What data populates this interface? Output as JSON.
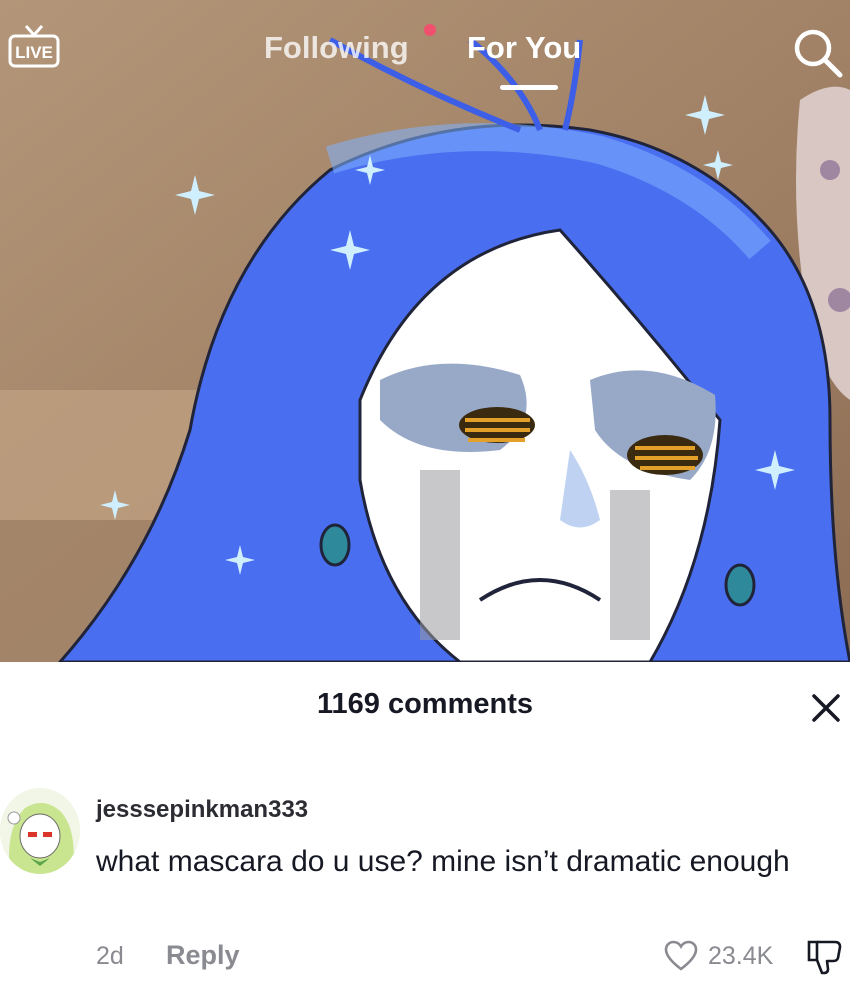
{
  "header": {
    "live_label": "LIVE",
    "tabs": [
      {
        "label": "Following",
        "active": false
      },
      {
        "label": "For You",
        "active": true
      }
    ]
  },
  "comments_panel": {
    "count_label": "1169 comments",
    "comments": [
      {
        "username": "jesssepinkman333",
        "text": "what mascara do u use? mine isn’t dramatic enough",
        "time": "2d",
        "reply_label": "Reply",
        "likes": "23.4K"
      }
    ]
  },
  "colors": {
    "hair": "#4a6ef0",
    "background_wall": "#a8896e",
    "notification_dot": "#f0506e",
    "secondary_text": "#8a8b91"
  },
  "icons": [
    "live-icon",
    "search-icon",
    "close-icon",
    "heart-icon",
    "dislike-icon"
  ]
}
